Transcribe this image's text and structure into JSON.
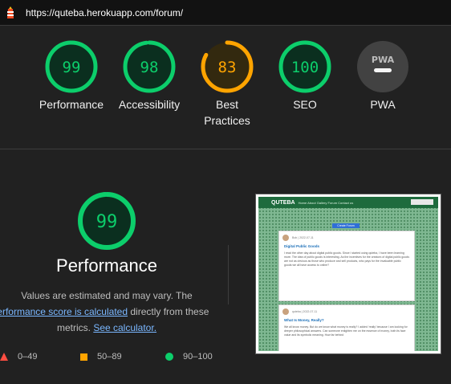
{
  "browser": {
    "url": "https://quteba.herokuapp.com/forum/",
    "logo_icon": "lighthouse-icon"
  },
  "colors": {
    "pass": "#0cce6b",
    "average": "#ffa400",
    "fail": "#ff4e42",
    "pwa": "#9e9e9e",
    "pass_bg": "#0b2f1f",
    "average_bg": "#33290f"
  },
  "categories": [
    {
      "score": "99",
      "label": "Performance",
      "value": 0.99,
      "rating": "pass"
    },
    {
      "score": "98",
      "label": "Accessibility",
      "value": 0.98,
      "rating": "pass"
    },
    {
      "score": "83",
      "label": "Best Practices",
      "value": 0.83,
      "rating": "average"
    },
    {
      "score": "100",
      "label": "SEO",
      "value": 1.0,
      "rating": "pass"
    },
    {
      "badge": "PWA",
      "label": "PWA",
      "rating": "pwa"
    }
  ],
  "performance": {
    "score": "99",
    "value": 0.99,
    "title": "Performance",
    "desc_part1": "Values are estimated and may vary. The",
    "desc_link1": "performance score is calculated",
    "desc_part2": "directly from these",
    "desc_part3": "metrics.",
    "desc_link2": "See calculator."
  },
  "legend": [
    {
      "range": "0–49",
      "shape": "triangle",
      "color": "#ff4e42"
    },
    {
      "range": "50–89",
      "shape": "square",
      "color": "#ffa400"
    },
    {
      "range": "90–100",
      "shape": "circle",
      "color": "#0cce6b"
    }
  ],
  "screenshot": {
    "brand": "QUTEBA",
    "nav_links": "Home  About  Gallery  Forum  Contact us",
    "button": "Create Forum",
    "post1": {
      "author": "Bob  |  2022-07-11",
      "title": "Digital Public Goods",
      "body": "I read the other day about digital public goods. Since I started using quteba, I have been learning more. The idea of public goods is interesting. As the incentives for the creators of digital public goods are not as obvious as those who produce and sell products, who pays for the invaluable public goods we all have access to online?"
    },
    "post2": {
      "author": "quteba  |  2022-07-11",
      "title": "What Is Money, Really?",
      "body": "We all know money. But do we know what money is really? I added 'really' because I am looking for deeper philosophical answers. Can someone enlighten me on the essence of money, both its face value and its symbolic meaning. How far behind"
    }
  }
}
